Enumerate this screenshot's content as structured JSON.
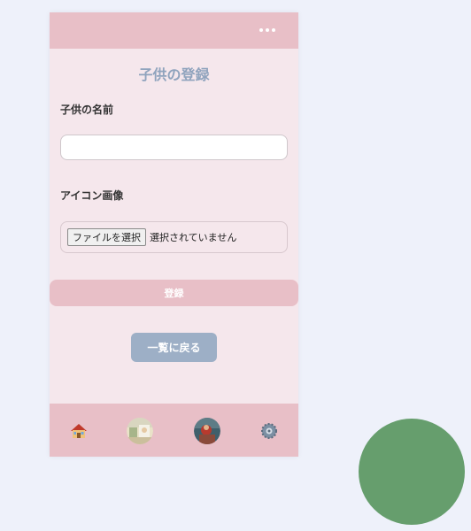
{
  "header": {
    "menu_icon": "more-horizontal-icon"
  },
  "page": {
    "title": "子供の登録"
  },
  "form": {
    "name_label": "子供の名前",
    "name_value": "",
    "name_placeholder": "",
    "icon_label": "アイコン画像",
    "file_button_label": "ファイルを選択",
    "file_status": "選択されていません",
    "submit_label": "登録",
    "back_label": "一覧に戻る"
  },
  "bottom_nav": {
    "items": [
      {
        "icon": "home-icon"
      },
      {
        "icon": "child-avatar-icon"
      },
      {
        "icon": "child-avatar-icon"
      },
      {
        "icon": "settings-gear-icon"
      }
    ]
  },
  "colors": {
    "background": "#eef1fa",
    "card": "#f5e7ec",
    "accent_pink": "#e8bfc7",
    "title_blue": "#8fa3bd",
    "back_button": "#9dafc6",
    "floating_circle": "#669e6d"
  }
}
